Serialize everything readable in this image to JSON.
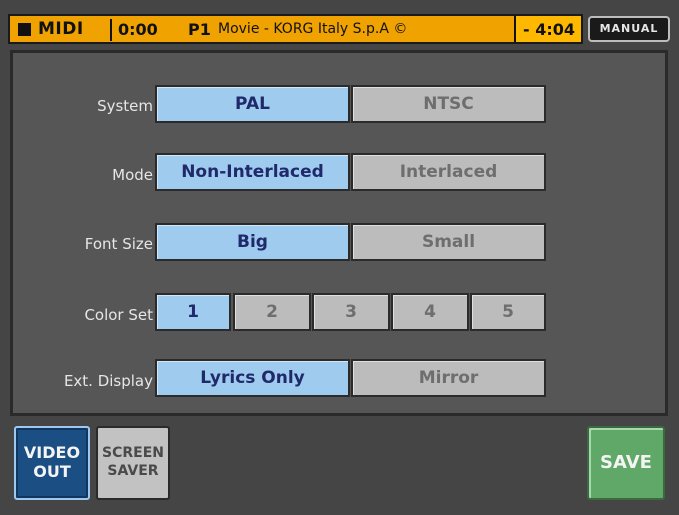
{
  "topbar": {
    "midi": "MIDI",
    "time": "0:00",
    "song_num": "P1",
    "song_title": "Movie - KORG Italy S.p.A ©",
    "remaining": "- 4:04"
  },
  "mode_badge": "MANUAL",
  "settings": {
    "system": {
      "label": "System",
      "options": [
        "PAL",
        "NTSC"
      ],
      "selected": "PAL"
    },
    "mode": {
      "label": "Mode",
      "options": [
        "Non-Interlaced",
        "Interlaced"
      ],
      "selected": "Non-Interlaced"
    },
    "font_size": {
      "label": "Font Size",
      "options": [
        "Big",
        "Small"
      ],
      "selected": "Big"
    },
    "color_set": {
      "label": "Color Set",
      "options": [
        "1",
        "2",
        "3",
        "4",
        "5"
      ],
      "selected": "1"
    },
    "ext_display": {
      "label": "Ext. Display",
      "options": [
        "Lyrics Only",
        "Mirror"
      ],
      "selected": "Lyrics Only"
    }
  },
  "bottom": {
    "video_out": [
      "VIDEO",
      "OUT"
    ],
    "screen_saver": [
      "SCREEN",
      "SAVER"
    ],
    "save": "SAVE"
  },
  "colors": {
    "topbar": "#f0a200",
    "selected": "#9fcbee",
    "unselected": "#bcbcbc",
    "save": "#5fa868",
    "video_out": "#1b4f84"
  }
}
